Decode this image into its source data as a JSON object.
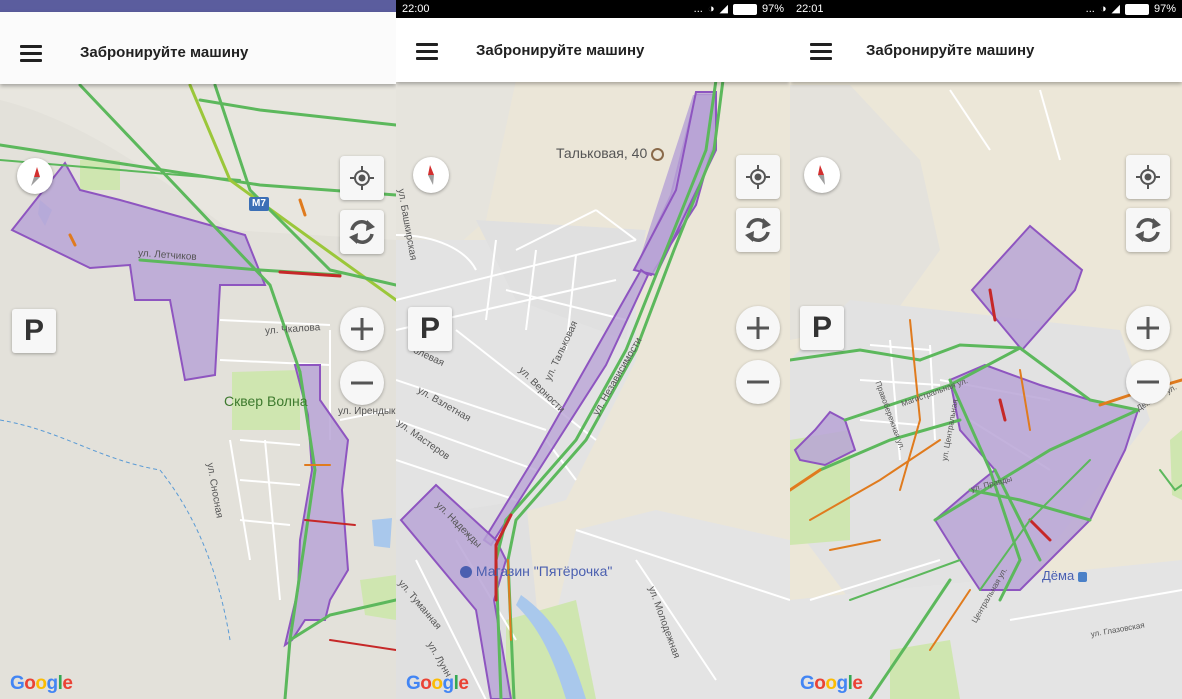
{
  "app": {
    "title": "Забронируйте машину",
    "parking_label": "P"
  },
  "status": {
    "panel2": {
      "time": "22:00",
      "battery": "97%",
      "dots": "..."
    },
    "panel3": {
      "time": "22:01",
      "battery": "97%",
      "dots": "..."
    }
  },
  "map1": {
    "highway_badge": "M7",
    "poi": "Сквер Волна",
    "streets": [
      "ул. Летчиков",
      "ул. Чкалова",
      "ул. Ирендык",
      "ул. Сносная"
    ]
  },
  "map2": {
    "address_poi": "Тальковая, 40",
    "shop_poi": "Магазин \"Пятёрочка\"",
    "streets": [
      "ул. Башкирская",
      "ул. Тальковая",
      "ул. Верности",
      "ул. Независимости",
      "олевая",
      "ул. Взлетная",
      "ул. Мастеров",
      "ул. Надежды",
      "ул. Туманная",
      "ул. Лунн",
      "ул. Молодежная"
    ]
  },
  "map3": {
    "stop_poi": "Дёма",
    "streets": [
      "Магистральная ул.",
      "ул. Правды",
      "Центральная ул.",
      "ул. Глазовская",
      "Дёмская ул.",
      "ул. Центральная",
      "Правобережная ул."
    ]
  },
  "google_logo": [
    "G",
    "o",
    "o",
    "g",
    "l",
    "e"
  ],
  "colors": {
    "zone_fill": "#b9a4d6",
    "zone_stroke": "#8e55c0",
    "traffic_green": "#5cb85c",
    "traffic_orange": "#e07b1e",
    "traffic_red": "#c62828",
    "park": "#cfe6b0",
    "water": "#a9c8ec"
  },
  "icons": [
    "menu-icon",
    "compass-icon",
    "my-location-icon",
    "refresh-icon",
    "zoom-in-icon",
    "zoom-out-icon",
    "parking-icon",
    "wifi-icon",
    "signal-icon",
    "battery-icon"
  ]
}
